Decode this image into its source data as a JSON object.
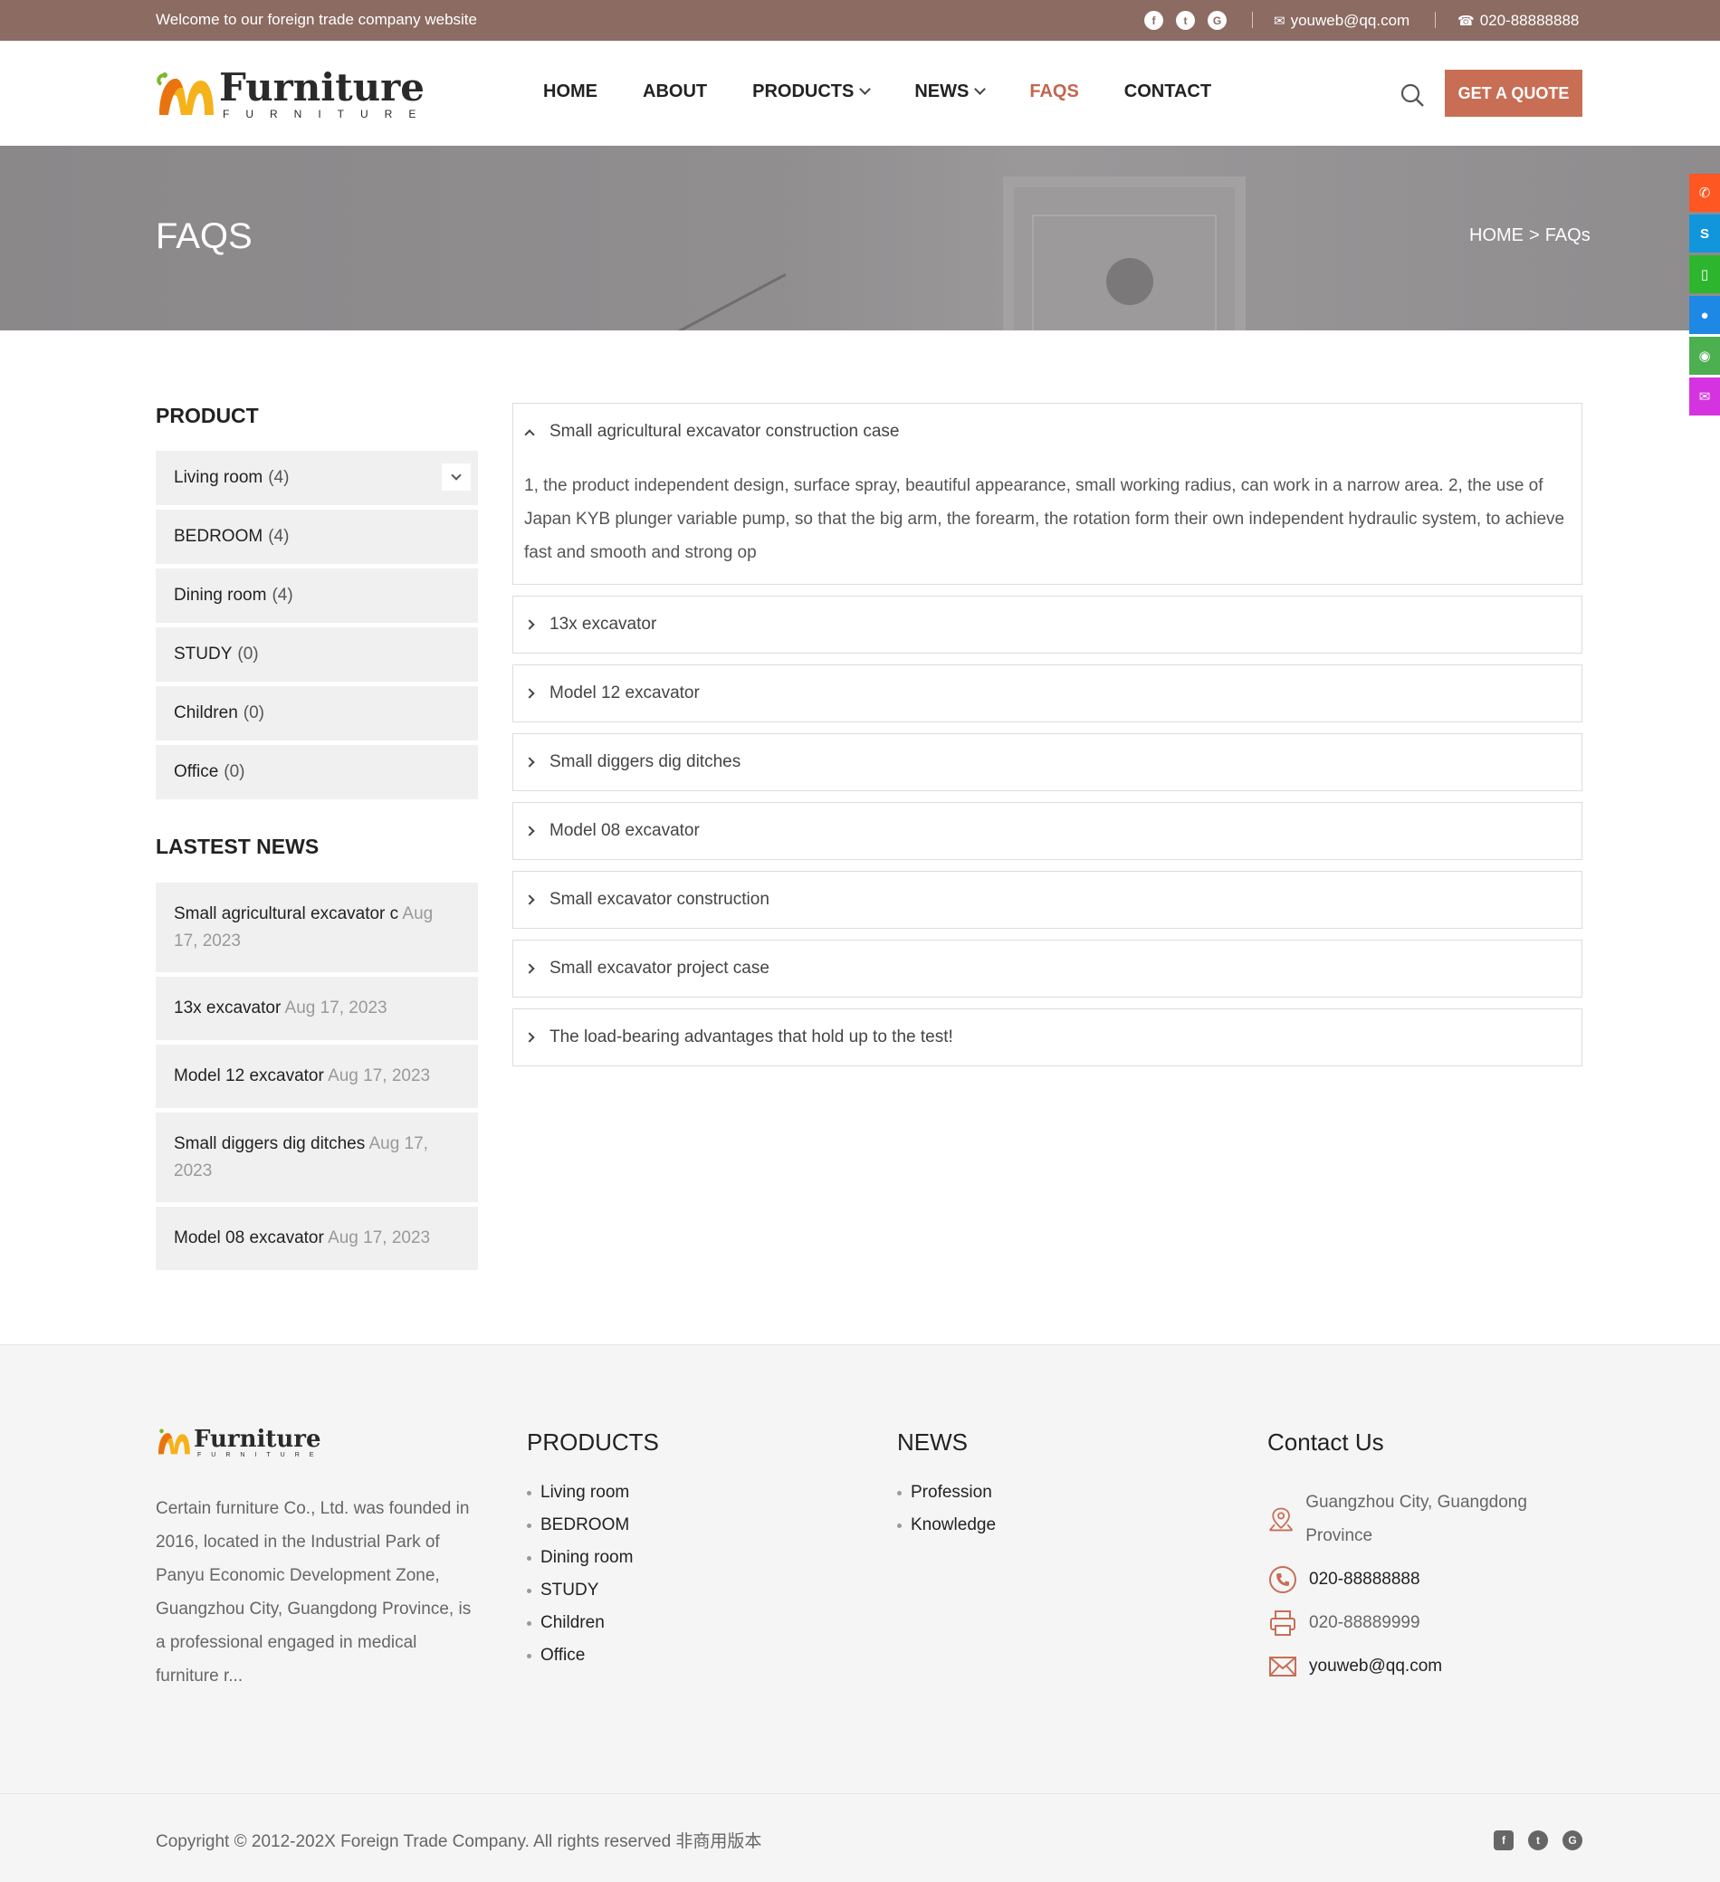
{
  "topbar": {
    "welcome": "Welcome to our foreign trade company website",
    "socials": [
      "facebook-icon",
      "twitter-icon",
      "google-icon"
    ],
    "email": "youweb@qq.com",
    "phone": "020-88888888"
  },
  "header": {
    "logo_title": "Furniture",
    "logo_sub": "FURNITURE",
    "nav": [
      {
        "label": "HOME"
      },
      {
        "label": "ABOUT"
      },
      {
        "label": "PRODUCTS"
      },
      {
        "label": "NEWS"
      },
      {
        "label": "FAQS"
      },
      {
        "label": "CONTACT"
      }
    ],
    "active_nav": "FAQS",
    "quote_button": "GET A QUOTE"
  },
  "banner": {
    "title": "FAQS",
    "breadcrumb": {
      "home": "HOME",
      "sep": ">",
      "current": "FAQs"
    }
  },
  "side_float_colors": [
    "#ff5722",
    "#1296db",
    "#2eb52e",
    "#1e88e5",
    "#4caf50",
    "#d633e0"
  ],
  "sidebar": {
    "product_heading": "PRODUCT",
    "categories": [
      {
        "name": "Living room",
        "count": "(4)"
      },
      {
        "name": "BEDROOM",
        "count": "(4)"
      },
      {
        "name": "Dining room",
        "count": "(4)"
      },
      {
        "name": "STUDY",
        "count": "(0)"
      },
      {
        "name": "Children",
        "count": "(0)"
      },
      {
        "name": "Office",
        "count": "(0)"
      }
    ],
    "news_heading": "LASTEST NEWS",
    "news": [
      {
        "title": "Small agricultural excavator c",
        "date": "Aug 17, 2023"
      },
      {
        "title": "13x excavator",
        "date": "Aug 17, 2023"
      },
      {
        "title": "Model 12 excavator",
        "date": "Aug 17, 2023"
      },
      {
        "title": "Small diggers dig ditches",
        "date": "Aug 17, 2023"
      },
      {
        "title": "Model 08 excavator",
        "date": "Aug 17, 2023"
      }
    ]
  },
  "faq": {
    "items": [
      {
        "q": "Small agricultural excavator construction case",
        "a": "1, the product independent design, surface spray, beautiful appearance, small working radius, can work in a narrow area. 2, the use of Japan KYB plunger variable pump, so that the big arm, the forearm, the rotation form their own independent hydraulic system, to achieve fast and smooth and strong op"
      },
      {
        "q": "13x excavator"
      },
      {
        "q": "Model 12 excavator"
      },
      {
        "q": "Small diggers dig ditches"
      },
      {
        "q": "Model 08 excavator"
      },
      {
        "q": "Small excavator construction"
      },
      {
        "q": "Small excavator project case"
      },
      {
        "q": "The load-bearing advantages that hold up to the test!"
      }
    ]
  },
  "footer": {
    "about": "Certain furniture Co., Ltd. was founded in 2016, located in the Industrial Park of Panyu Economic Development Zone, Guangzhou City, Guangdong Province, is a professional engaged in medical furniture r...",
    "products_heading": "PRODUCTS",
    "products": [
      "Living room",
      "BEDROOM",
      "Dining room",
      "STUDY",
      "Children",
      "Office"
    ],
    "news_heading": "NEWS",
    "news": [
      "Profession",
      "Knowledge"
    ],
    "contact_heading": "Contact Us",
    "address": "Guangzhou City, Guangdong Province",
    "phone": "020-88888888",
    "fax": "020-88889999",
    "email": "youweb@qq.com",
    "copyright": "Copyright © 2012-202X Foreign Trade Company. All rights reserved 非商用版本"
  }
}
